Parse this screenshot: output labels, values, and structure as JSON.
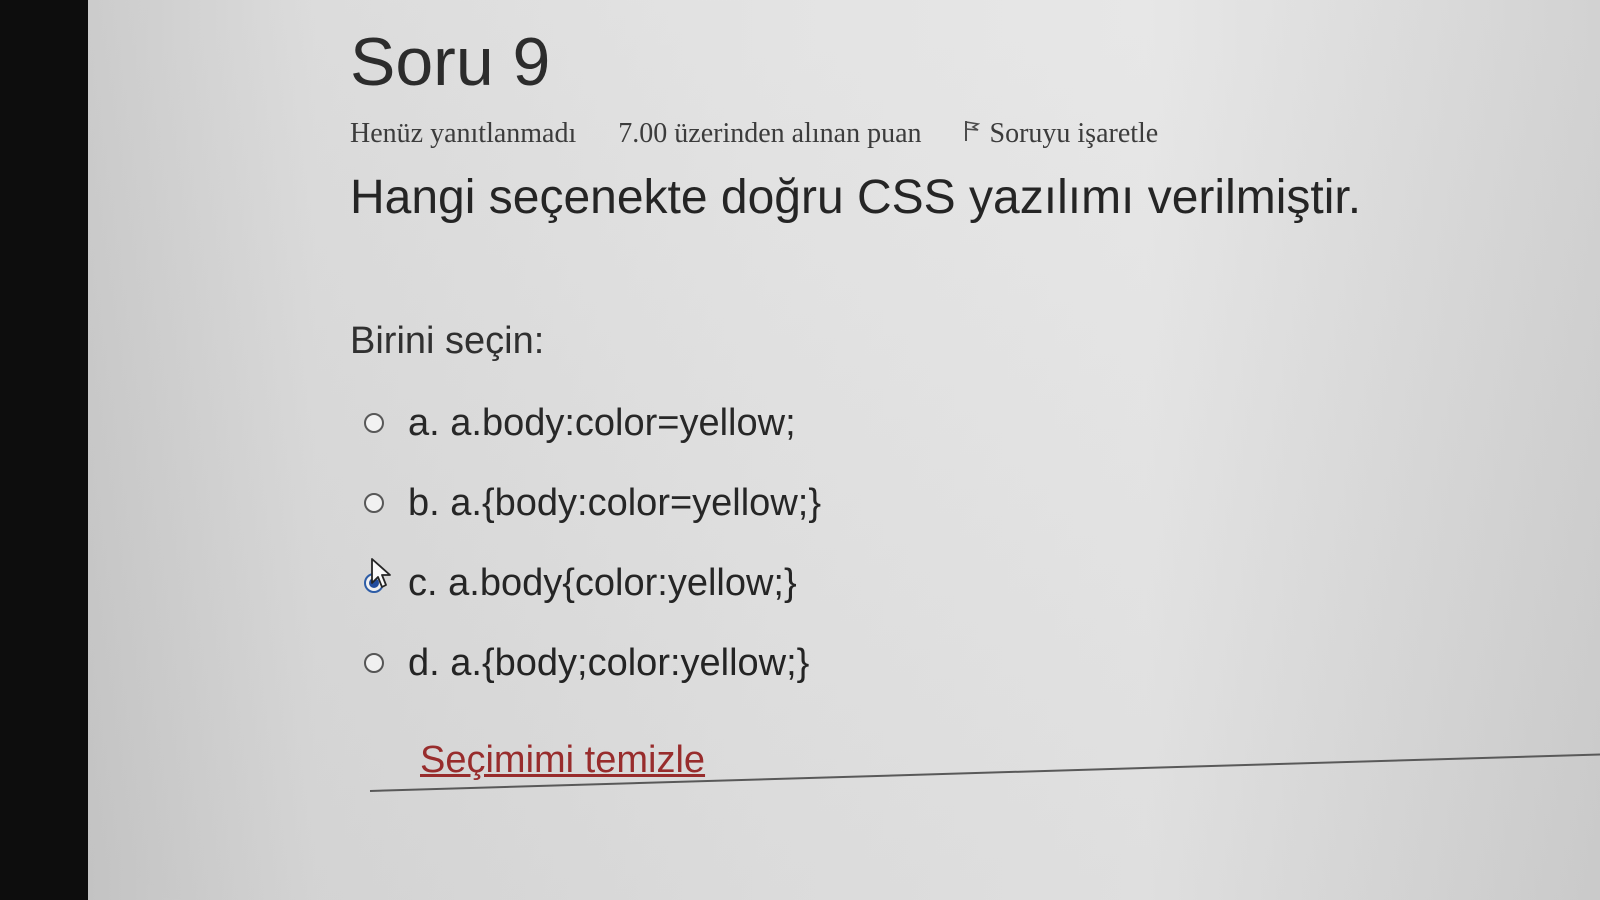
{
  "question_header": {
    "title": "Soru 9",
    "status": "Henüz yanıtlanmadı",
    "points": "7.00 üzerinden alınan puan",
    "flag_label": "Soruyu işaretle",
    "flag_icon": "flag-icon"
  },
  "question_text": "Hangi seçenekte doğru CSS yazılımı verilmiştir.",
  "prompt": "Birini seçin:",
  "options": [
    {
      "letter": "a.",
      "text": "a.body:color=yellow;",
      "selected": false
    },
    {
      "letter": "b.",
      "text": "a.{body:color=yellow;}",
      "selected": false
    },
    {
      "letter": "c.",
      "text": "a.body{color:yellow;}",
      "selected": true
    },
    {
      "letter": "d.",
      "text": "a.{body;color:yellow;}",
      "selected": false
    }
  ],
  "clear_selection": "Seçimimi temizle",
  "colors": {
    "link": "#9b2c2c",
    "radio_selected": "#1e4aa0"
  }
}
